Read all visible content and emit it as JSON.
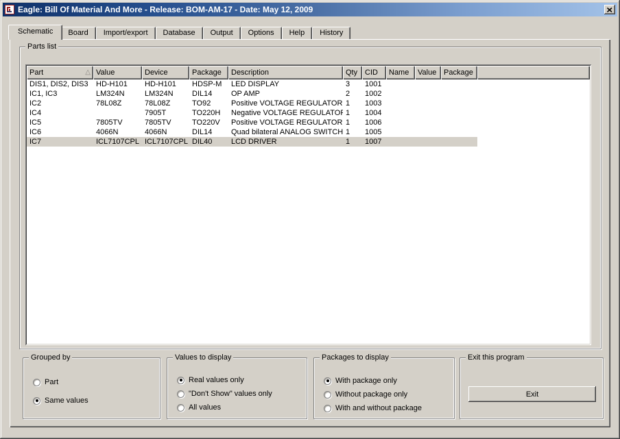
{
  "window": {
    "title": "Eagle: Bill Of Material And More - Release: BOM-AM-17 - Date: May 12, 2009"
  },
  "tabs": [
    {
      "label": "Schematic",
      "active": true
    },
    {
      "label": "Board",
      "active": false
    },
    {
      "label": "Import/export",
      "active": false
    },
    {
      "label": "Database",
      "active": false
    },
    {
      "label": "Output",
      "active": false
    },
    {
      "label": "Options",
      "active": false
    },
    {
      "label": "Help",
      "active": false
    },
    {
      "label": "History",
      "active": false
    }
  ],
  "parts_list": {
    "group_label": "Parts list",
    "columns": [
      "Part",
      "Value",
      "Device",
      "Package",
      "Description",
      "Qty",
      "CID",
      "Name",
      "Value",
      "Package"
    ],
    "sort_column": "Part",
    "rows": [
      {
        "part": "DIS1, DIS2, DIS3",
        "value": "HD-H101",
        "device": "HD-H101",
        "package": "HDSP-M",
        "description": "LED DISPLAY",
        "qty": "3",
        "cid": "1001",
        "name": "",
        "value2": "",
        "package2": "",
        "selected": false
      },
      {
        "part": "IC1, IC3",
        "value": "LM324N",
        "device": "LM324N",
        "package": "DIL14",
        "description": "OP AMP",
        "qty": "2",
        "cid": "1002",
        "name": "",
        "value2": "",
        "package2": "",
        "selected": false
      },
      {
        "part": "IC2",
        "value": "78L08Z",
        "device": "78L08Z",
        "package": "TO92",
        "description": "Positive VOLTAGE REGULATOR",
        "qty": "1",
        "cid": "1003",
        "name": "",
        "value2": "",
        "package2": "",
        "selected": false
      },
      {
        "part": "IC4",
        "value": "",
        "device": "7905T",
        "package": "TO220H",
        "description": "Negative VOLTAGE REGULATOR",
        "qty": "1",
        "cid": "1004",
        "name": "",
        "value2": "",
        "package2": "",
        "selected": false
      },
      {
        "part": "IC5",
        "value": "7805TV",
        "device": "7805TV",
        "package": "TO220V",
        "description": "Positive VOLTAGE REGULATOR",
        "qty": "1",
        "cid": "1006",
        "name": "",
        "value2": "",
        "package2": "",
        "selected": false
      },
      {
        "part": "IC6",
        "value": "4066N",
        "device": "4066N",
        "package": "DIL14",
        "description": "Quad bilateral ANALOG SWITCH",
        "qty": "1",
        "cid": "1005",
        "name": "",
        "value2": "",
        "package2": "",
        "selected": false
      },
      {
        "part": "IC7",
        "value": "ICL7107CPL",
        "device": "ICL7107CPL",
        "package": "DIL40",
        "description": "LCD DRIVER",
        "qty": "1",
        "cid": "1007",
        "name": "",
        "value2": "",
        "package2": "",
        "selected": true
      }
    ]
  },
  "grouped_by": {
    "group_label": "Grouped by",
    "options": [
      {
        "label": "Part",
        "selected": false
      },
      {
        "label": "Same values",
        "selected": true
      }
    ]
  },
  "values_to_display": {
    "group_label": "Values to display",
    "options": [
      {
        "label": "Real values only",
        "selected": true
      },
      {
        "label": "\"Don't Show\" values only",
        "selected": false
      },
      {
        "label": "All values",
        "selected": false
      }
    ]
  },
  "packages_to_display": {
    "group_label": "Packages to display",
    "options": [
      {
        "label": "With package only",
        "selected": true
      },
      {
        "label": "Without package only",
        "selected": false
      },
      {
        "label": "With and without package",
        "selected": false
      }
    ]
  },
  "exit_group": {
    "group_label": "Exit this program",
    "button_label": "Exit"
  },
  "colors": {
    "face": "#d4d0c8",
    "titlebar_left": "#0f3169",
    "titlebar_right": "#a3c2e8",
    "selection": "#d4d0c8",
    "list_background": "#ffffff"
  }
}
